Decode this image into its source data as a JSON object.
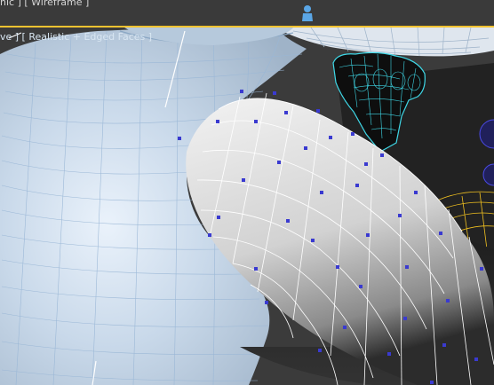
{
  "viewports": {
    "top": {
      "label_prefix": "hic ] [",
      "shading_mode": "Wireframe",
      "label_suffix": "]",
      "border_color": "#f2c230"
    },
    "perspective": {
      "label_prefix": "ve ] [",
      "shading_mode": "Realistic + Edged Faces",
      "label_suffix": "]",
      "background_color": "#3b3b3b",
      "objects": {
        "body_color": "#c8d8e8",
        "wire_color": "#8fb4d9",
        "limb_color": "#dcdcdc",
        "vertex_color": "#3a3ad0",
        "hand_wire_color": "#3fd7e6",
        "yellow_wire_color": "#f0c020",
        "blue_sphere_color": "#4a4ae6"
      }
    }
  }
}
